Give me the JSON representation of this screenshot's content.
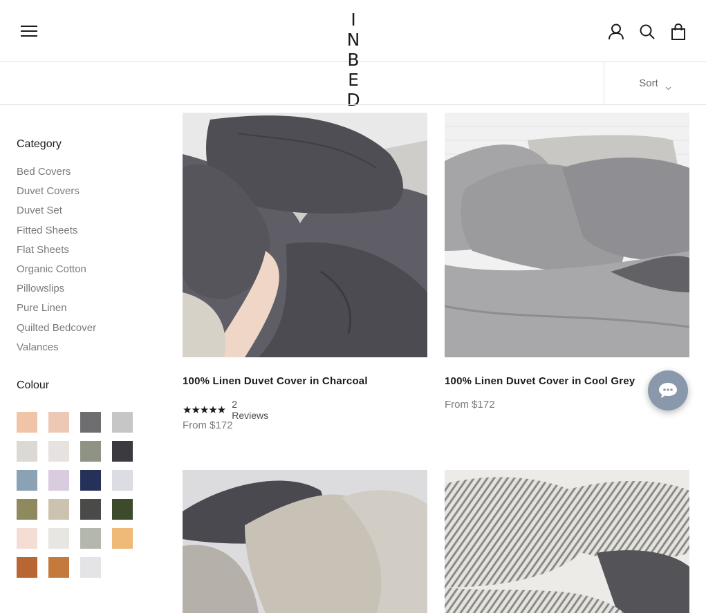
{
  "header": {
    "logo_line1": "I N",
    "logo_line2": "B E D"
  },
  "toolbar": {
    "sort_label": "Sort"
  },
  "sidebar": {
    "category_title": "Category",
    "categories": [
      "Bed Covers",
      "Duvet Covers",
      "Duvet Set",
      "Fitted Sheets",
      "Flat Sheets",
      "Organic Cotton",
      "Pillowslips",
      "Pure Linen",
      "Quilted Bedcover",
      "Valances"
    ],
    "colour_title": "Colour",
    "swatches": [
      "#f0c4a6",
      "#edc8b5",
      "#6e6e70",
      "#c6c6c6",
      "#dcd9d4",
      "#e6e2df",
      "#8f9383",
      "#3b3a3e",
      "#8ba1b4",
      "#d9ccdf",
      "#26315a",
      "#dcdde3",
      "#8f8a5e",
      "#cbc3b0",
      "#4a4a48",
      "#3e4a2c",
      "#f3ddd5",
      "#e7e6e2",
      "#b4b7ad",
      "#efb977",
      "#b86633",
      "#c47a3c",
      "#e4e4e6"
    ]
  },
  "products": [
    {
      "title": "100% Linen Duvet Cover in Charcoal",
      "rating_stars": "★★★★★",
      "reviews": "2 Reviews",
      "price": "From $172"
    },
    {
      "title": "100% Linen Duvet Cover in Cool Grey",
      "price": "From $172"
    }
  ]
}
